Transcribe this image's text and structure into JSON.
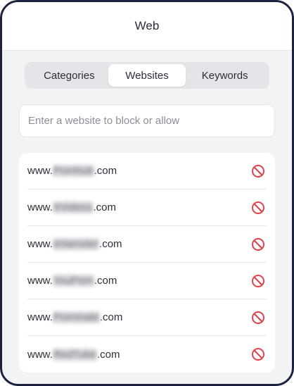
{
  "header": {
    "title": "Web"
  },
  "tabs": [
    {
      "label": "Categories",
      "active": false
    },
    {
      "label": "Websites",
      "active": true
    },
    {
      "label": "Keywords",
      "active": false
    }
  ],
  "search": {
    "placeholder": "Enter a website to block or allow",
    "value": ""
  },
  "sites": [
    {
      "prefix": "www.",
      "name": "Pornhub",
      "suffix": ".com"
    },
    {
      "prefix": "www.",
      "name": "XVideos",
      "suffix": ".com"
    },
    {
      "prefix": "www.",
      "name": "xHamster",
      "suffix": ".com"
    },
    {
      "prefix": "www.",
      "name": "YouPorn",
      "suffix": ".com"
    },
    {
      "prefix": "www.",
      "name": "Pornmate",
      "suffix": ".com"
    },
    {
      "prefix": "www.",
      "name": "RedTube",
      "suffix": ".com"
    }
  ],
  "icons": {
    "block": "block-icon"
  },
  "colors": {
    "block": "#e0424b",
    "active_tab": "#ffffff",
    "tab_track": "#e4e5e8"
  }
}
